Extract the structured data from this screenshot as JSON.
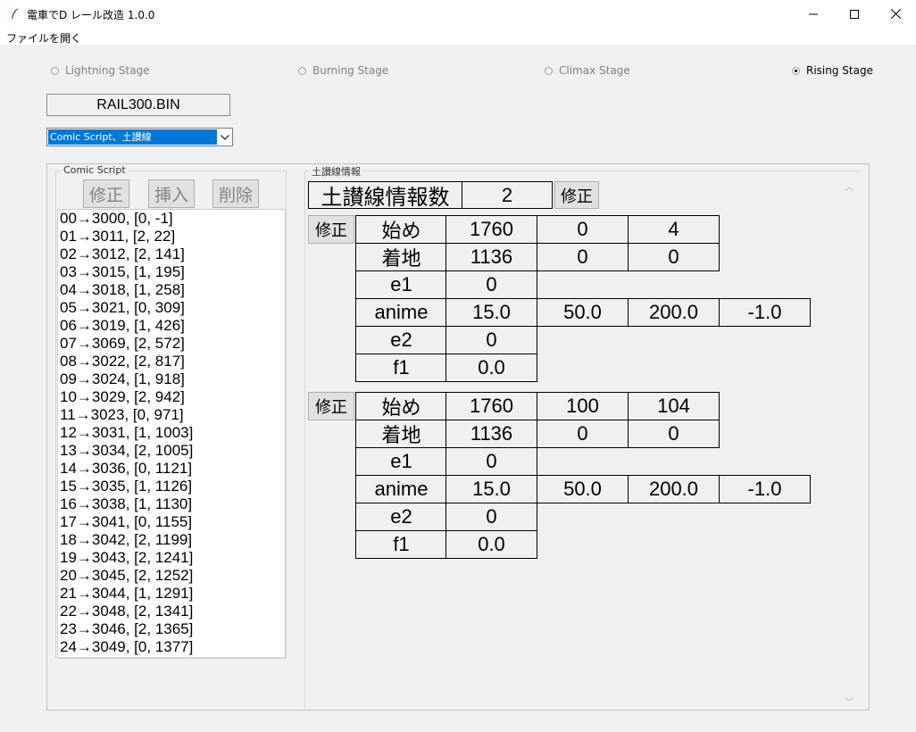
{
  "window": {
    "title": "電車でD レール改造 1.0.0",
    "controls": {
      "minimize": "—",
      "maximize": "☐",
      "close": "✕"
    }
  },
  "menu": {
    "open_file": "ファイルを開く"
  },
  "stages": [
    {
      "label": "Lightning Stage",
      "selected": false
    },
    {
      "label": "Burning Stage",
      "selected": false
    },
    {
      "label": "Climax Stage",
      "selected": false
    },
    {
      "label": "Rising Stage",
      "selected": true
    }
  ],
  "file_name": "RAIL300.BIN",
  "section_select": {
    "value": "Comic Script、土讃線"
  },
  "comic_script": {
    "title": "Comic Script",
    "edit_label": "修正",
    "insert_label": "挿入",
    "delete_label": "削除",
    "items": [
      "00→3000, [0, -1]",
      "01→3011, [2, 22]",
      "02→3012, [2, 141]",
      "03→3015, [1, 195]",
      "04→3018, [1, 258]",
      "05→3021, [0, 309]",
      "06→3019, [1, 426]",
      "07→3069, [2, 572]",
      "08→3022, [2, 817]",
      "09→3024, [1, 918]",
      "10→3029, [2, 942]",
      "11→3023, [0, 971]",
      "12→3031, [1, 1003]",
      "13→3034, [2, 1005]",
      "14→3036, [0, 1121]",
      "15→3035, [1, 1126]",
      "16→3038, [1, 1130]",
      "17→3041, [0, 1155]",
      "18→3042, [2, 1199]",
      "19→3043, [2, 1241]",
      "20→3045, [2, 1252]",
      "21→3044, [1, 1291]",
      "22→3048, [2, 1341]",
      "23→3046, [2, 1365]",
      "24→3049, [0, 1377]"
    ]
  },
  "line_info": {
    "title": "土讃線情報",
    "count_label": "土讃線情報数",
    "count_value": "2",
    "edit_label": "修正",
    "entries": [
      {
        "edit_label": "修正",
        "start": {
          "label": "始め",
          "values": [
            "1760",
            "0",
            "4"
          ]
        },
        "landing": {
          "label": "着地",
          "values": [
            "1136",
            "0",
            "0"
          ]
        },
        "e1": {
          "label": "e1",
          "value": "0"
        },
        "anime": {
          "label": "anime",
          "values": [
            "15.0",
            "50.0",
            "200.0",
            "-1.0"
          ]
        },
        "e2": {
          "label": "e2",
          "value": "0"
        },
        "f1": {
          "label": "f1",
          "value": "0.0"
        }
      },
      {
        "edit_label": "修正",
        "start": {
          "label": "始め",
          "values": [
            "1760",
            "100",
            "104"
          ]
        },
        "landing": {
          "label": "着地",
          "values": [
            "1136",
            "0",
            "0"
          ]
        },
        "e1": {
          "label": "e1",
          "value": "0"
        },
        "anime": {
          "label": "anime",
          "values": [
            "15.0",
            "50.0",
            "200.0",
            "-1.0"
          ]
        },
        "e2": {
          "label": "e2",
          "value": "0"
        },
        "f1": {
          "label": "f1",
          "value": "0.0"
        }
      }
    ]
  }
}
